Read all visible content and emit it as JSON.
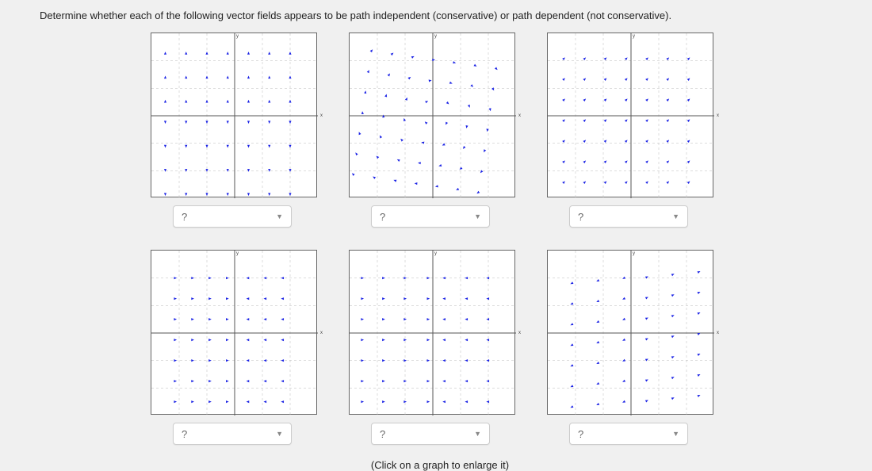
{
  "prompt": "Determine whether each of the following vector fields appears to be path independent (conservative) or path dependent (not conservative).",
  "axis_x_label": "x",
  "axis_y_label": "y",
  "dropdown_placeholder": "?",
  "hint": "(Click on a graph to enlarge it)",
  "fields": [
    {
      "id": "f1",
      "fx": "0",
      "fy": "y/6",
      "dropdown": "?"
    },
    {
      "id": "f2",
      "fx": "y/6",
      "fy": "-x/6",
      "dropdown": "?"
    },
    {
      "id": "f3",
      "fx": "0.25",
      "fy": "0.25",
      "dropdown": "?"
    },
    {
      "id": "f4",
      "fx": "-x/6",
      "fy": "0",
      "dropdown": "?"
    },
    {
      "id": "f5",
      "fx": "-(1/(1+abs(x)))*sign(x)*0.5 - 0.05",
      "fy": "0",
      "dropdown": "?"
    },
    {
      "id": "f6",
      "fx": "x/4",
      "fy": "x/8",
      "dropdown": "?"
    }
  ]
}
